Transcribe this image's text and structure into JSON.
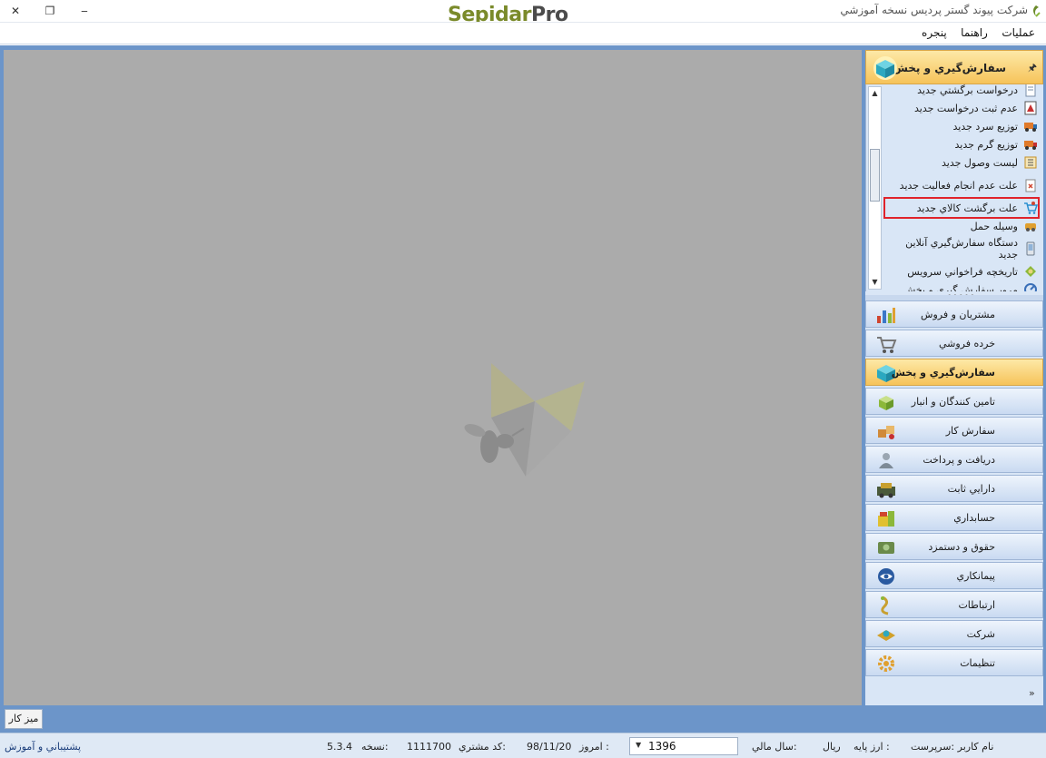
{
  "titlebar": {
    "app_title": "شرکت پیوند گستر پردیس نسخه آموزشي",
    "logo_part1": "Sepidar",
    "logo_part2": "Pro",
    "close_glyph": "✕",
    "restore_glyph": "❐",
    "minimize_glyph": "‒"
  },
  "menu": {
    "items": [
      "عمليات",
      "راهنما",
      "پنجره"
    ]
  },
  "panel": {
    "header_title": "سفارش‌گيري و پخش",
    "pin_glyph": "🖈",
    "tasks": [
      {
        "label": "درخواست برگشتي جديد",
        "icon": "doc-icon",
        "color": "#7a8fa8"
      },
      {
        "label": "عدم ثبت درخواست جديد",
        "icon": "flask-icon",
        "color": "#c63030"
      },
      {
        "label": "توزيع سرد جديد",
        "icon": "truck-icon",
        "color": "#e07a2a"
      },
      {
        "label": "توزيع گرم جديد",
        "icon": "truck-icon",
        "color": "#e07a2a"
      },
      {
        "label": "ليست وصول جديد",
        "icon": "list-icon",
        "color": "#c4902a"
      },
      {
        "label": "علت عدم انجام فعاليت جديد",
        "icon": "clipboard-icon",
        "color": "#d0452f"
      },
      {
        "label": "علت برگشت کالاي جديد",
        "icon": "cart-icon",
        "color": "#2a8fd0"
      },
      {
        "label": "وسيله حمل",
        "icon": "vehicle-icon",
        "color": "#e0a030"
      },
      {
        "label": "دستگاه سفارش‌گيري آنلاين جديد",
        "icon": "device-icon",
        "color": "#6d7d8d"
      },
      {
        "label": "تاريخچه فراخواني سرويس",
        "icon": "history-icon",
        "color": "#8cb83a"
      },
      {
        "label": "مرور سفارش گيري و پخش",
        "icon": "review-icon",
        "color": "#3a6fb8"
      }
    ],
    "nav": [
      {
        "label": "مشتريان و فروش",
        "icon": "chart-icon",
        "color": "#3a78c8"
      },
      {
        "label": "خرده فروشي",
        "icon": "retail-cart-icon",
        "color": "#777"
      },
      {
        "label": "سفارش‌گيري و پخش",
        "icon": "box-icon",
        "color": "#2bb0c8"
      },
      {
        "label": "تامين کنندگان و انبار",
        "icon": "warehouse-icon",
        "color": "#8cb83a"
      },
      {
        "label": "سفارش کار",
        "icon": "work-order-icon",
        "color": "#d08a3a"
      },
      {
        "label": "دريافت و پرداخت",
        "icon": "payment-icon",
        "color": "#7d8a96"
      },
      {
        "label": "دارايي ثابت",
        "icon": "asset-icon",
        "color": "#8a9a3a"
      },
      {
        "label": "حسابداري",
        "icon": "accounting-icon",
        "color": "#d0a02a"
      },
      {
        "label": "حقوق و دستمزد",
        "icon": "payroll-icon",
        "color": "#6a8a4a"
      },
      {
        "label": "پيمانکاري",
        "icon": "contract-icon",
        "color": "#2a5aa0"
      },
      {
        "label": "ارتباطات",
        "icon": "communication-icon",
        "color": "#c8a030"
      },
      {
        "label": "شرکت",
        "icon": "company-icon",
        "color": "#d0a02a"
      },
      {
        "label": "تنظيمات",
        "icon": "settings-icon",
        "color": "#e0a030"
      }
    ],
    "footer_glyph": "»"
  },
  "desktop_tab": "ميز کار",
  "status": {
    "user": "نام کاربر :سرپرست",
    "base_currency_label": "ارز پايه :",
    "base_currency": "ريال",
    "fiscal_year_label": "سال مالي:",
    "fiscal_year": "1396",
    "today_label": "امروز :",
    "today": "98/11/20",
    "customer_code_label": "کد مشتري:",
    "customer_code": "1111700",
    "version_label": "نسخه:",
    "version": "5.3.4",
    "support": "پشتيباني و آموزش"
  }
}
